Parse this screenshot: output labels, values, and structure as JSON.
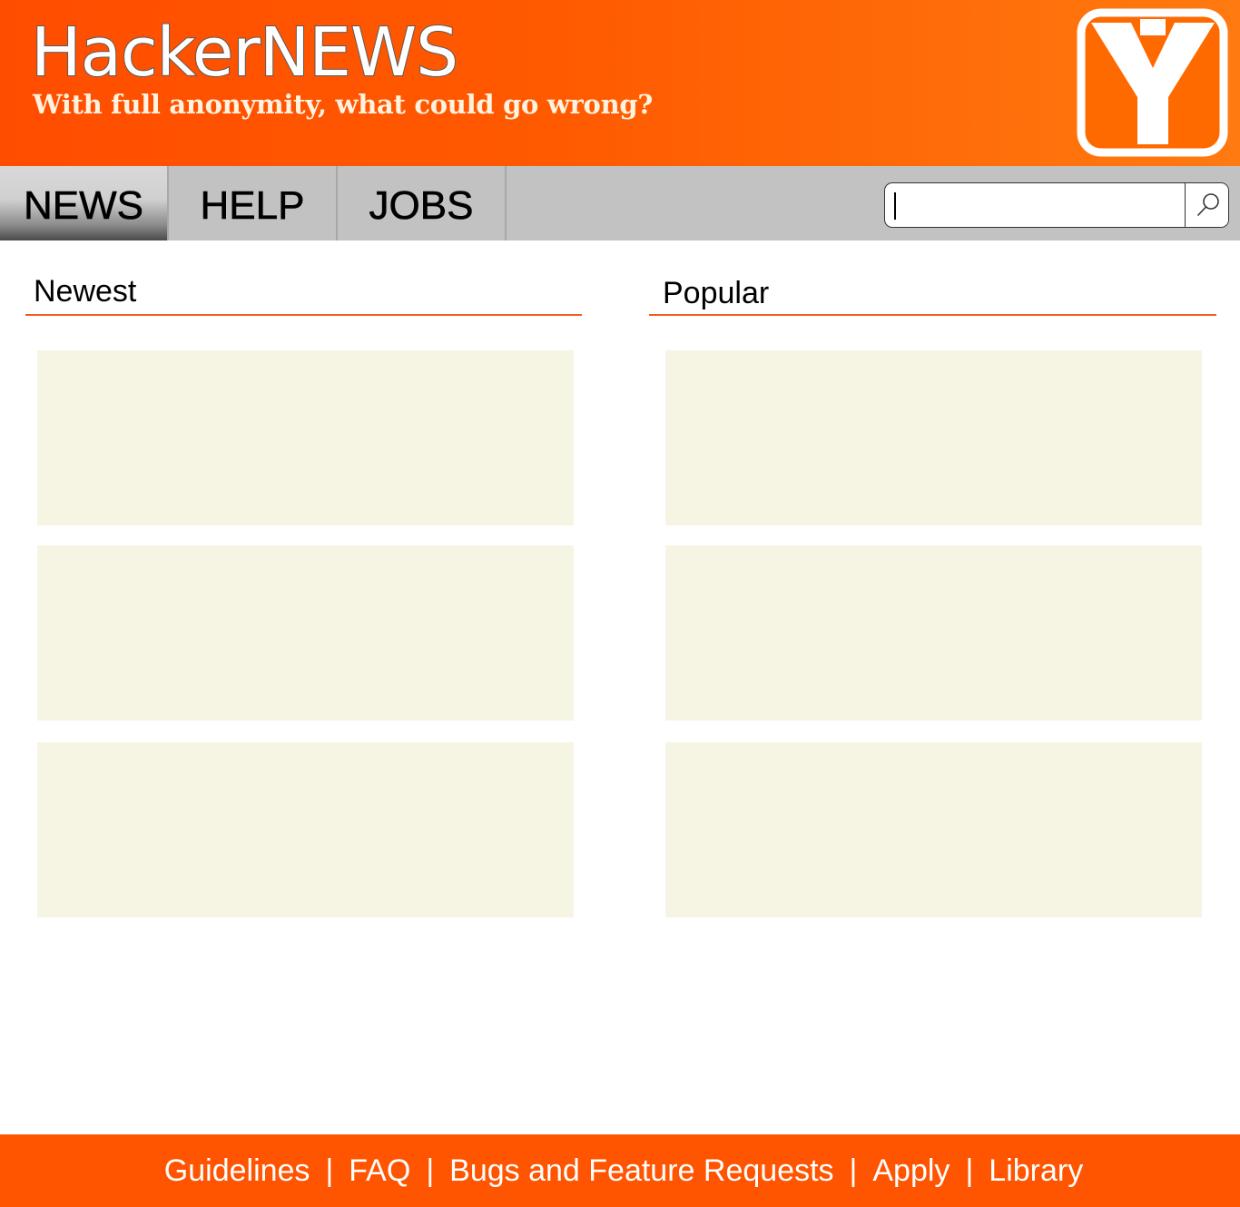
{
  "header": {
    "title": "HackerNEWS",
    "tagline": "With full anonymity, what could go wrong?",
    "logo_letter": "Y"
  },
  "nav": {
    "tabs": [
      {
        "label": "NEWS",
        "active": true
      },
      {
        "label": "HELP",
        "active": false
      },
      {
        "label": "JOBS",
        "active": false
      }
    ]
  },
  "search": {
    "value": "",
    "placeholder": "",
    "icon": "search-icon"
  },
  "columns": {
    "newest": {
      "title": "Newest",
      "cards": 3
    },
    "popular": {
      "title": "Popular",
      "cards": 3
    }
  },
  "footer": {
    "links": [
      "Guidelines",
      "FAQ",
      "Bugs and Feature Requests",
      "Apply",
      "Library"
    ],
    "separator": "|"
  },
  "colors": {
    "header_orange": "#ff5a00",
    "footer_orange": "#ff5400",
    "nav_gray": "#c2c2c2",
    "card_bg": "#f6f5e3",
    "accent_rule": "#f25a1c"
  }
}
